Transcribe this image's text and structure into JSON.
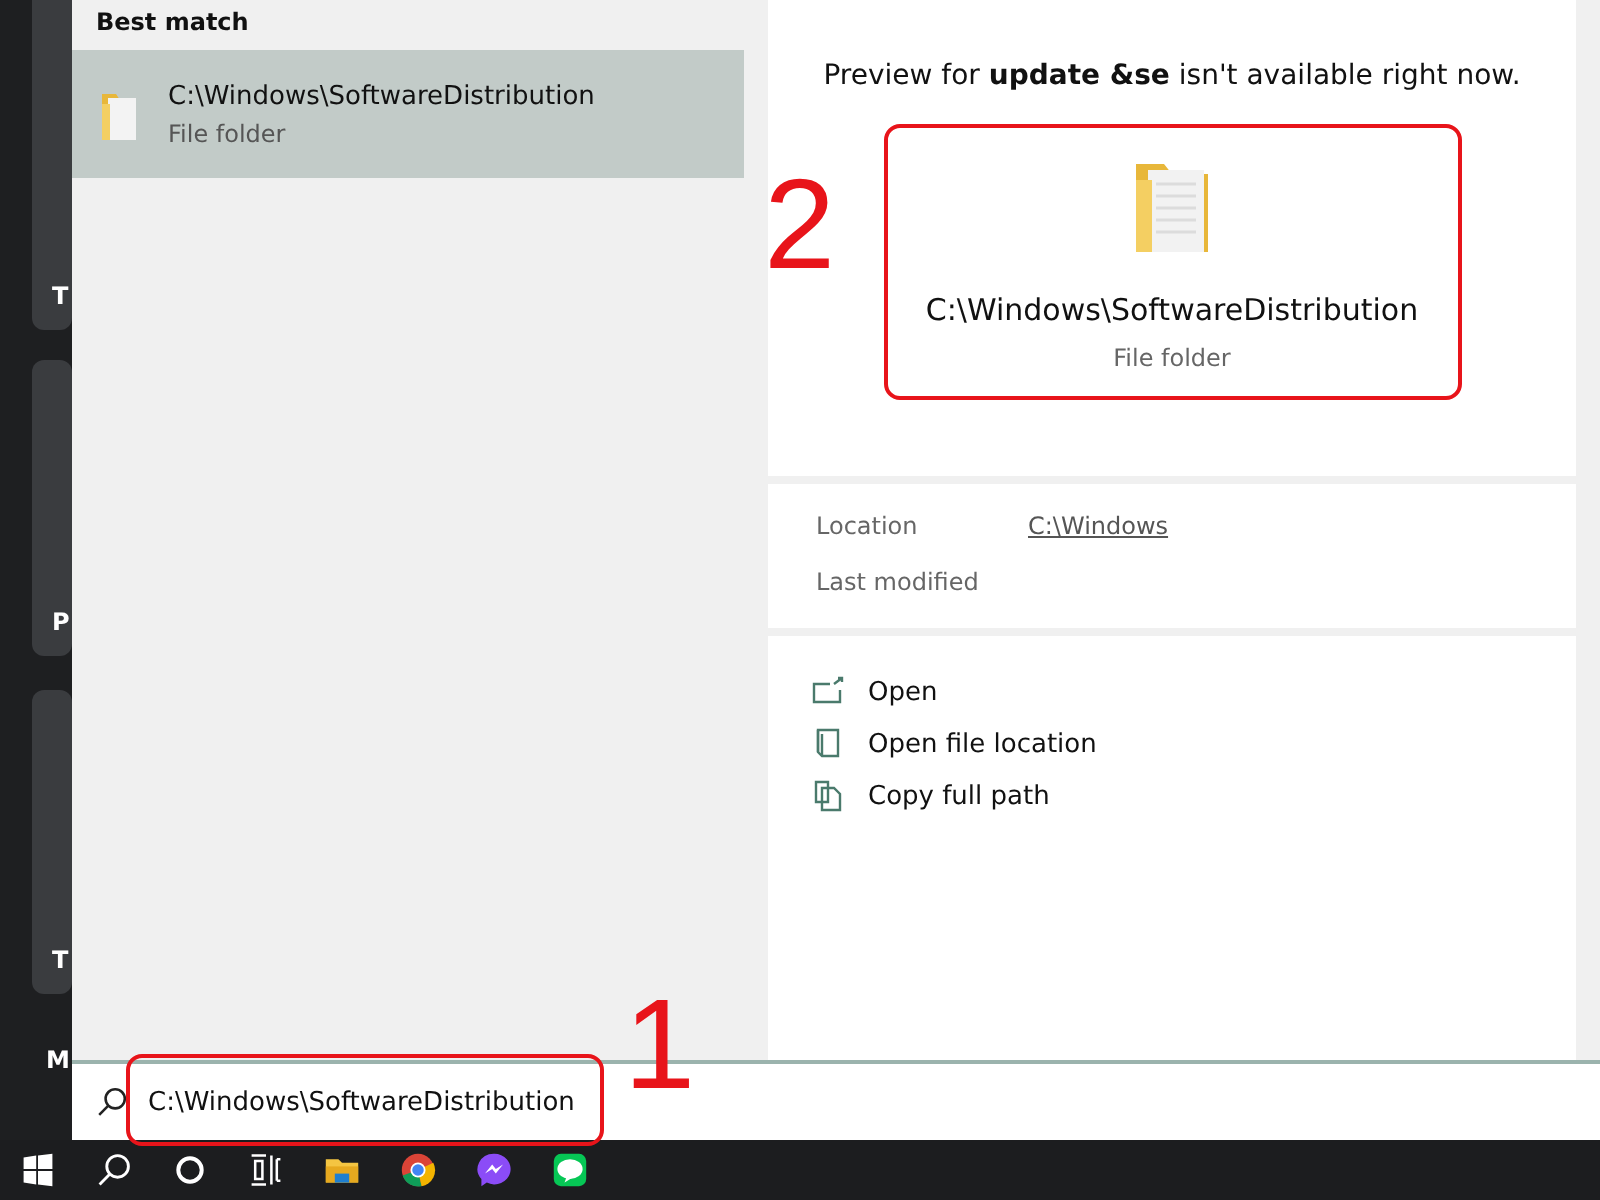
{
  "start_tiles": [
    {
      "label": "T"
    },
    {
      "label": "P"
    },
    {
      "label": "T"
    }
  ],
  "side_label": "M",
  "results": {
    "heading": "Best match",
    "items": [
      {
        "name": "C:\\Windows\\SoftwareDistribution",
        "type": "File folder",
        "selected": true
      }
    ]
  },
  "preview": {
    "header": "Preview for **update &se** isn't available right now.",
    "name": "C:\\Windows\\SoftwareDistribution",
    "type": "File folder",
    "details": [
      {
        "label": "Location",
        "value": "C:\\Windows"
      },
      {
        "label": "Last modified"
      }
    ],
    "actions": [
      {
        "label": "Open",
        "kind": "open"
      },
      {
        "label": "Open file location",
        "kind": "location"
      },
      {
        "label": "Copy full path",
        "kind": "copy"
      }
    ]
  },
  "search": {
    "value": "C:\\Windows\\SoftwareDistribution"
  },
  "preview_annotation": {
    "label": "2"
  },
  "search_annotation": {
    "label": "1"
  }
}
